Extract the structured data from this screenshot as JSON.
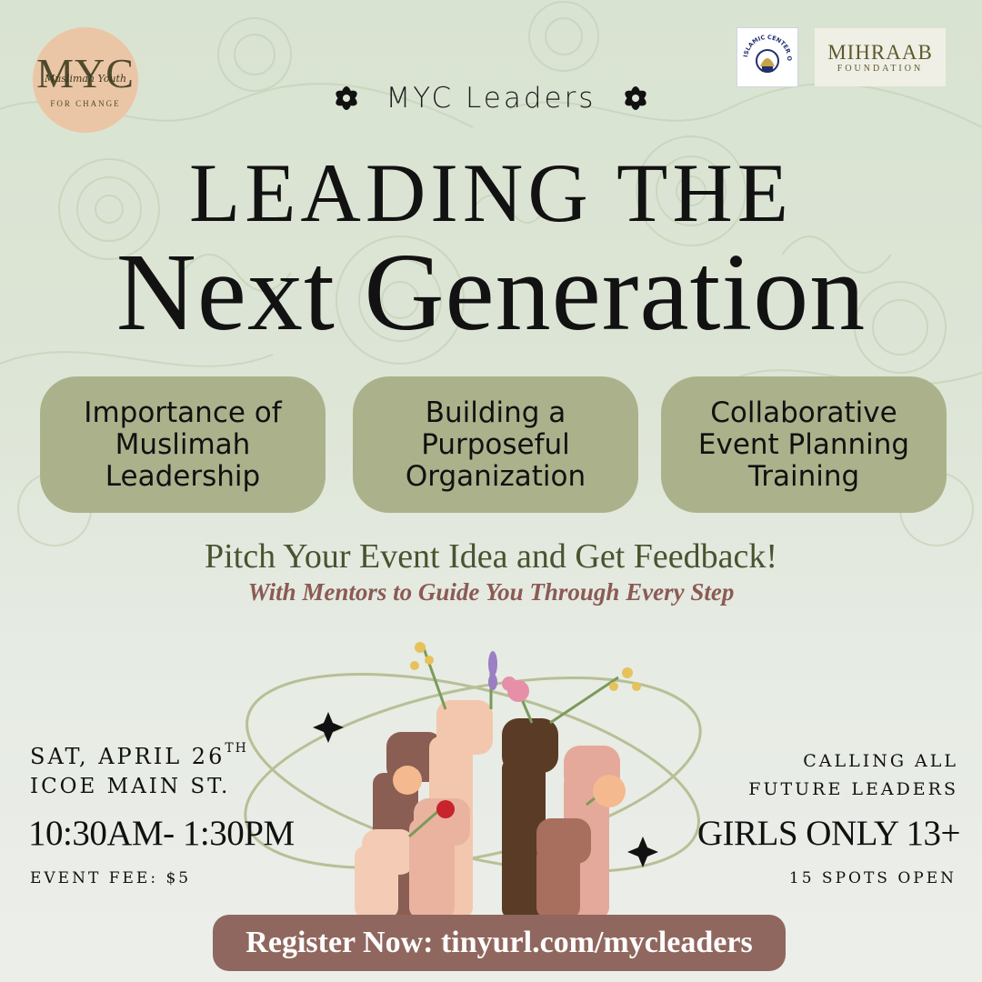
{
  "logos": {
    "myc": {
      "big": "MYC",
      "script": "Muslimah Youth",
      "small": "FOR CHANGE"
    },
    "ice": {
      "name": "ISLAMIC CENTER OF EASTSIDE"
    },
    "mihraab": {
      "line1": "MIHRAAB",
      "line2": "FOUNDATION"
    }
  },
  "header": {
    "kicker": "MYC Leaders",
    "title_line1": "LEADING THE",
    "title_line2": "Next Generation"
  },
  "pills": [
    {
      "label": "Importance of\nMuslimah\nLeadership"
    },
    {
      "label": "Building a\nPurposeful\nOrganization"
    },
    {
      "label": "Collaborative\nEvent Planning\nTraining"
    }
  ],
  "pitch": {
    "headline": "Pitch Your Event Idea and Get Feedback!",
    "subline": "With Mentors to Guide You Through Every Step"
  },
  "event": {
    "date": "SAT, APRIL 26",
    "date_suffix": "TH",
    "location": "ICOE MAIN ST.",
    "time": "10:30AM- 1:30PM",
    "fee": "EVENT FEE: $5"
  },
  "audience": {
    "calling": "CALLING ALL\nFUTURE LEADERS",
    "eligibility": "GIRLS ONLY 13+",
    "spots": "15 SPOTS OPEN"
  },
  "register": {
    "label": "Register Now: tinyurl.com/mycleaders"
  },
  "colors": {
    "pill": "#abb28b",
    "pitch_text": "#4a5330",
    "mentor_text": "#8c5a55",
    "register_bg": "#90675e",
    "logo_circle": "#ebc6a6"
  },
  "icons": [
    "flower-icon",
    "sparkle-icon"
  ]
}
